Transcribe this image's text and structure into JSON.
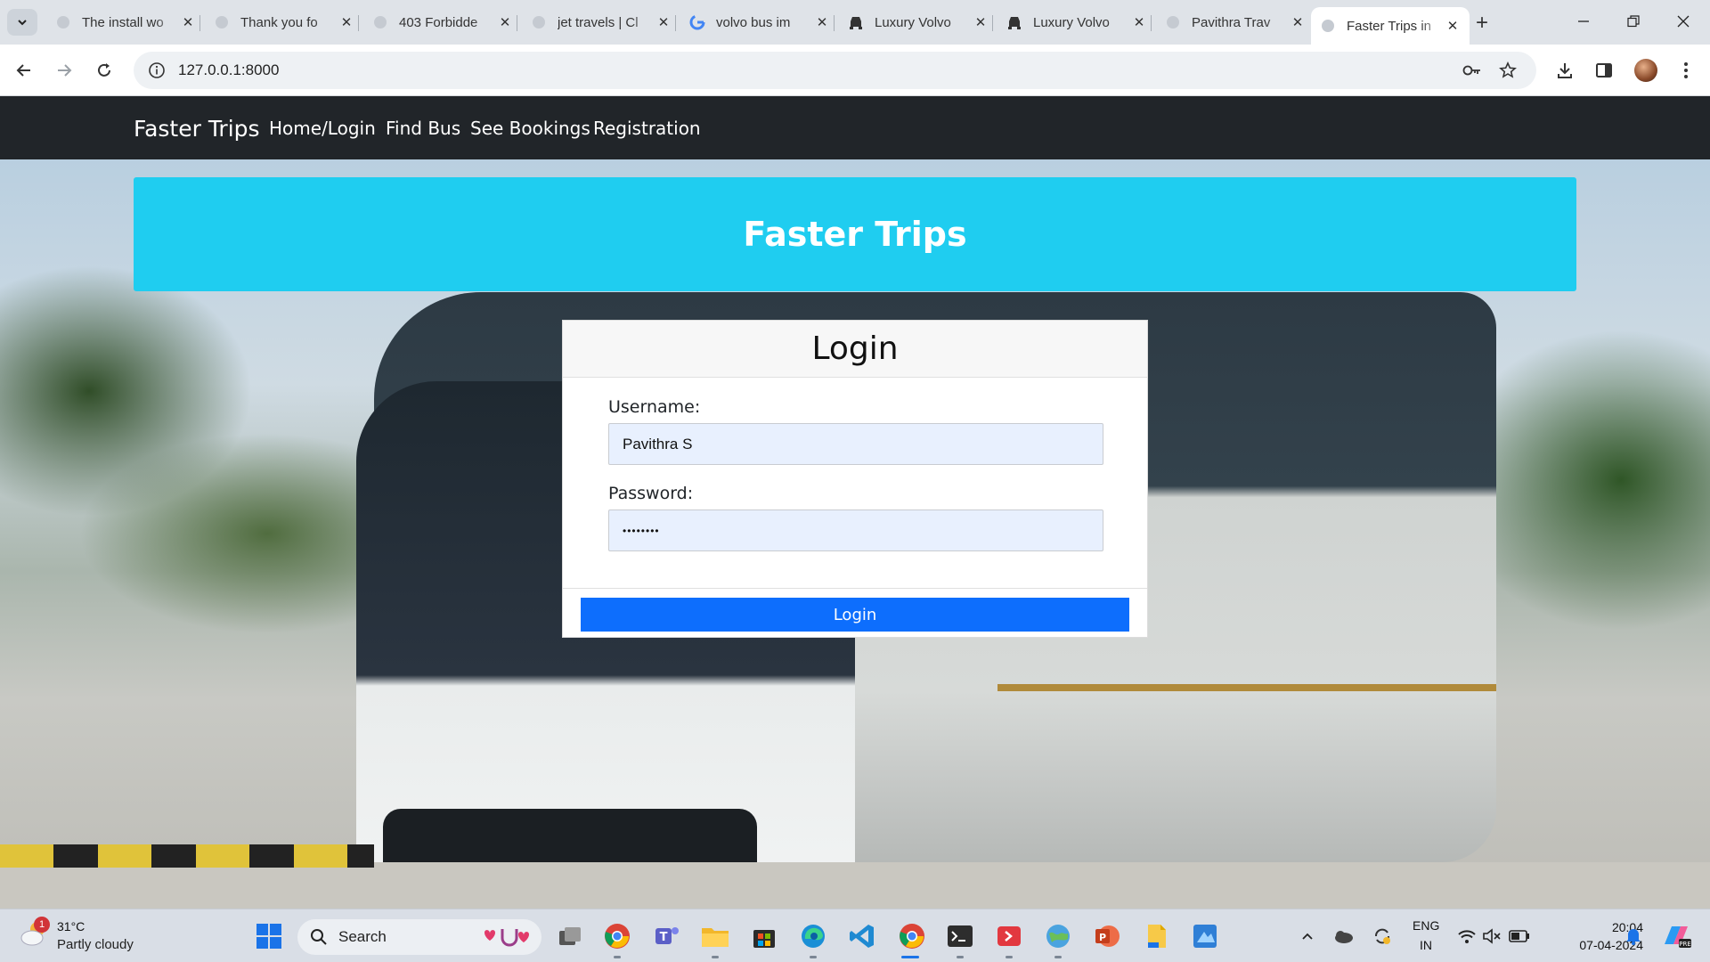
{
  "browser": {
    "tabs": [
      {
        "title": "The install wo",
        "favicon": "globe-icon"
      },
      {
        "title": "Thank you fo",
        "favicon": "globe-icon"
      },
      {
        "title": "403 Forbidde",
        "favicon": "globe-icon"
      },
      {
        "title": "jet travels | Cl",
        "favicon": "globe-icon"
      },
      {
        "title": "volvo bus im",
        "favicon": "google-icon"
      },
      {
        "title": "Luxury Volvo",
        "favicon": "car-icon"
      },
      {
        "title": "Luxury Volvo",
        "favicon": "car-icon"
      },
      {
        "title": "Pavithra Trav",
        "favicon": "globe-icon"
      },
      {
        "title": "Faster Trips in",
        "favicon": "globe-icon",
        "active": true
      }
    ],
    "url": "127.0.0.1:8000"
  },
  "navbar": {
    "brand": "Faster Trips",
    "links": [
      "Home/Login",
      "Find Bus",
      "See Bookings",
      "Registration"
    ]
  },
  "banner": {
    "title": "Faster Trips",
    "color": "#1fcdf0"
  },
  "login": {
    "title": "Login",
    "username_label": "Username:",
    "username_value": "Pavithra S",
    "password_label": "Password:",
    "password_value": "••••••••",
    "button_label": "Login",
    "button_color": "#0d6efd"
  },
  "taskbar": {
    "weather": {
      "temp": "31°C",
      "desc": "Partly cloudy",
      "badge": "1"
    },
    "search_label": "Search",
    "tray": {
      "lang_top": "ENG",
      "lang_bottom": "IN"
    },
    "clock": {
      "time": "20:04",
      "date": "07-04-2024"
    }
  }
}
